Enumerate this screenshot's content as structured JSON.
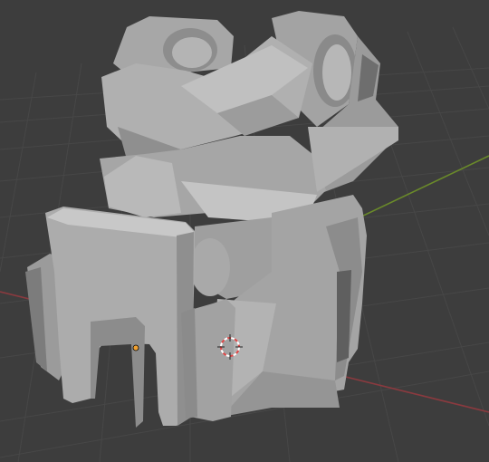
{
  "viewport": {
    "background_color": "#3d3d3d",
    "grid_line_color": "#474747",
    "axis_x_color": "#8a3a3f",
    "axis_y_color": "#6a8a2a",
    "grid_visible": true
  },
  "model": {
    "description_icon": "mesh-object",
    "base_color": "#a9a9a9",
    "shadow_color": "#7d7d7d",
    "highlight_color": "#c6c6c6",
    "dark_color": "#5c5c5c"
  },
  "cursor_3d": {
    "icon": "3d-cursor-icon",
    "ring_color_a": "#e04848",
    "ring_color_b": "#ffffff"
  },
  "origin_point": {
    "icon": "object-origin-icon",
    "color": "#f0a030"
  }
}
